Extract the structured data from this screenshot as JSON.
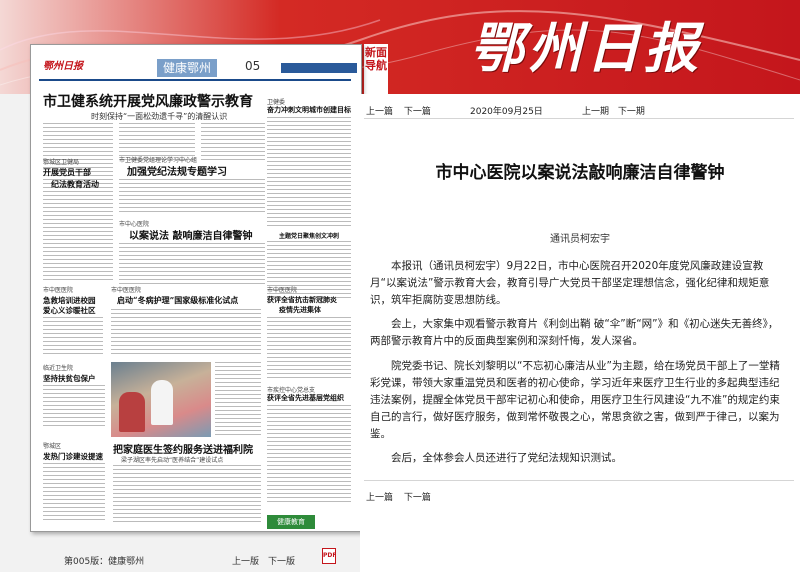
{
  "masthead": "鄂州日报",
  "nav_badge": "新面导航",
  "paper": {
    "logo": "鄂州日报",
    "section": "健康鄂州",
    "page_number": "05",
    "headline": "市卫健系统开展党风廉政警示教育",
    "subheadline": "时刻保持“一面松劲遗千寻”的清醒认识",
    "col_heads": {
      "left1": "鄂城区卫健局",
      "mid1": "市卫健委党组理论学习中心组",
      "right1": "卫健委",
      "mid2": "市中心医院",
      "left2": "市中医医院",
      "mid3": "市中医医院",
      "left3": "临近卫生院",
      "right2": "市中医医院",
      "left4": "鄂城区",
      "right3": "市疾控中心党总支"
    },
    "titles": {
      "right1": "奋力冲刺文明城市创建目标",
      "left1a": "开展党员干部",
      "left1b": "纪法教育活动",
      "mid1": "加强党纪法规专题学习",
      "mid2": "以案说法  敲响廉洁自律警钟",
      "right2": "主题党日聚焦创文冲刺",
      "left2a": "急救培训进校园",
      "left2b": "爱心义诊暖社区",
      "mid3": "启动“冬病护理”国家级标准化试点",
      "right3a": "获评全省抗击新冠肺炎",
      "right3b": "疫情先进集体",
      "left3": "坚持扶贫包保户",
      "right4": "获评全省先进基层党组织",
      "left4": "发热门诊建设提速",
      "mid4": "把家庭医生签约服务送进福利院",
      "mid4sub": "梁子湖区率先启动“医养结合”建设试点"
    },
    "badge": "健康教育"
  },
  "paper_footer": {
    "page_label": "第005版：健康鄂州",
    "prev": "上一版",
    "next": "下一版",
    "pdf": "PDF"
  },
  "right_nav": {
    "top": {
      "prev": "上一篇",
      "next": "下一篇"
    },
    "date": "2020年09月25日",
    "prev_issue": "上一期",
    "next_issue": "下一期",
    "bottom": {
      "prev": "上一篇",
      "next": "下一篇"
    }
  },
  "article": {
    "title": "市中心医院以案说法敲响廉洁自律警钟",
    "byline": "通讯员柯宏宇",
    "paragraphs": [
      "本报讯（通讯员柯宏宇）9月22日，市中心医院召开2020年度党风廉政建设宣教月“以案说法”警示教育大会，教育引导广大党员干部坚定理想信念，强化纪律和规矩意识，筑牢拒腐防变思想防线。",
      "会上，大家集中观看警示教育片《利剑出鞘  破“伞”断“网”》和《初心迷失无善终》，两部警示教育片中的反面典型案例和深刻忏悔，发人深省。",
      "院党委书记、院长刘黎明以“不忘初心廉洁从业”为主题，给在场党员干部上了一堂精彩党课，带领大家重温党员和医者的初心使命，学习近年来医疗卫生行业的多起典型违纪违法案例，提醒全体党员干部牢记初心和使命，用医疗卫生行风建设“九不准”的规定约束自己的言行，做好医疗服务，做到常怀敬畏之心，常思贪欲之害，做到严于律己，以案为鉴。",
      "会后，全体参会人员还进行了党纪法规知识测试。"
    ]
  },
  "colors": {
    "brand_red": "#c4161c",
    "section_blue": "#7a9fc9"
  }
}
